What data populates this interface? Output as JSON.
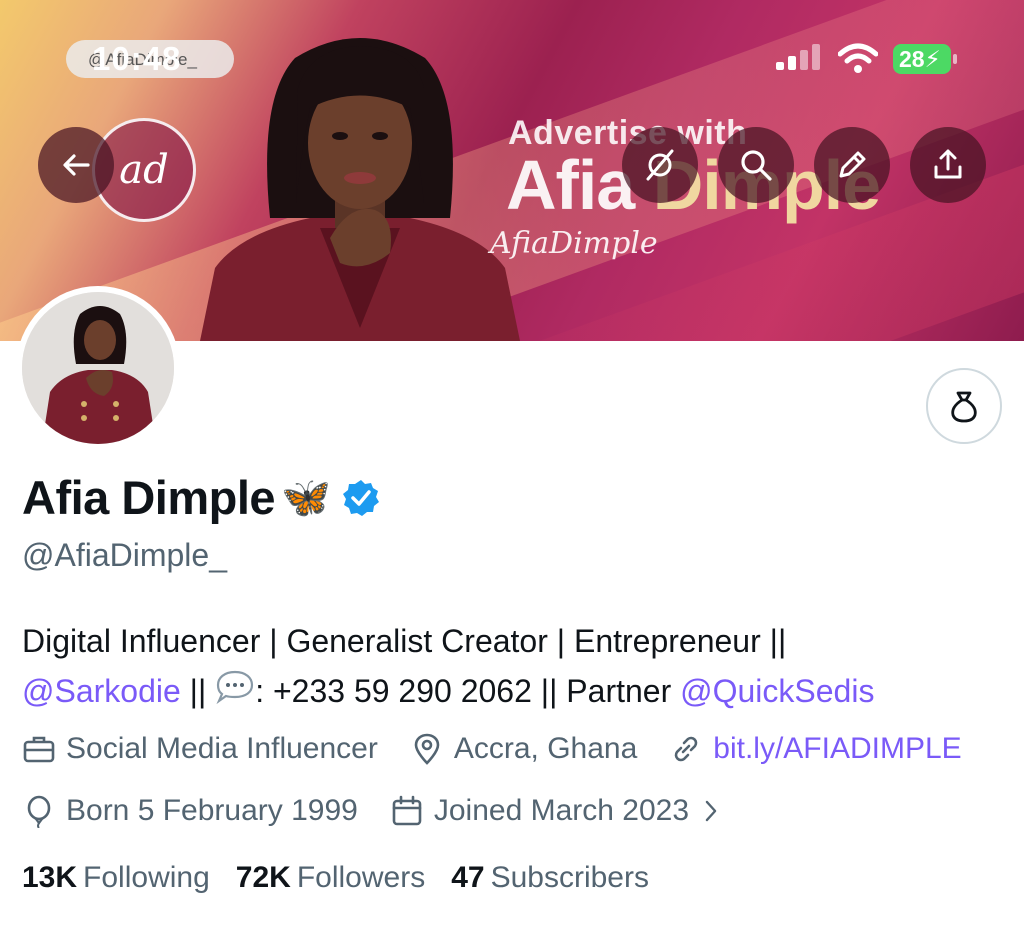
{
  "status_bar": {
    "time": "10:48",
    "time_overlay_handle": "@AfiaDimple_",
    "battery": "28"
  },
  "banner": {
    "headline_small": "Advertise with",
    "headline_big_1": "Afia",
    "headline_big_2": "Dimple",
    "signature": "AfiaDimple",
    "logo_text": "ad"
  },
  "toolbar": {
    "back_icon": "arrow-left-icon",
    "grok_icon": "grok-icon",
    "search_icon": "search-icon",
    "edit_icon": "pencil-icon",
    "share_icon": "share-icon"
  },
  "profile": {
    "name": "Afia Dimple",
    "emoji": "🦋",
    "handle": "@AfiaDimple_",
    "bio_line1": "Digital Influencer | Generalist Creator | Entrepreneur ||",
    "bio_mention1": "@Sarkodie",
    "bio_sep1": " || ",
    "bio_phone": ": +233 59 290 2062 || Partner ",
    "bio_mention2": "@QuickSedis",
    "category": "Social Media Influencer",
    "location": "Accra, Ghana",
    "website": "bit.ly/AFIADIMPLE",
    "born": "Born 5 February 1999",
    "joined": "Joined March 2023"
  },
  "stats": {
    "following_count": "13K",
    "following_label": "Following",
    "followers_count": "72K",
    "followers_label": "Followers",
    "subscribers_count": "47",
    "subscribers_label": "Subscribers"
  },
  "colors": {
    "accent_link": "#7a5af8",
    "verified": "#1d9bf0",
    "battery": "#4cd964"
  }
}
